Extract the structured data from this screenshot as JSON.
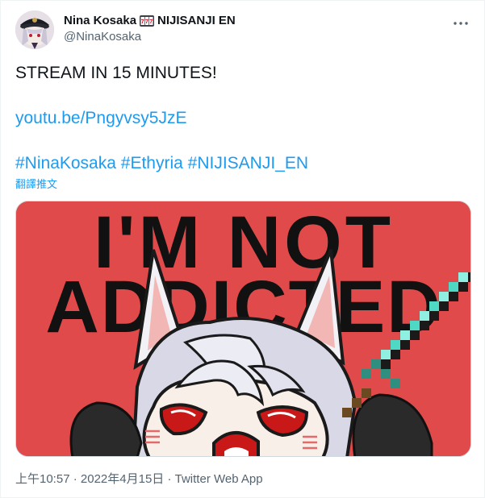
{
  "author": {
    "display_name": "Nina Kosaka",
    "affiliation": "NIJISANJI EN",
    "handle": "@NinaKosaka"
  },
  "tweet": {
    "line1": "STREAM IN 15 MINUTES!",
    "link": "youtu.be/Pngyvsy5JzE",
    "hashtags": [
      "#NinaKosaka",
      "#Ethyria",
      "#NIJISANJI_EN"
    ],
    "translate_label": "翻譯推文"
  },
  "media": {
    "headline_line1": "I'M NOT",
    "headline_line2": "ADDICTED",
    "background_color": "#e14a4a"
  },
  "meta": {
    "time": "上午10:57",
    "separator": "·",
    "date": "2022年4月15日",
    "app": "Twitter Web App"
  },
  "colors": {
    "link": "#1d9bf0",
    "secondary_text": "#536471"
  },
  "icons": {
    "more": "more-horizontal-icon",
    "emoji": "slot-machine-icon"
  }
}
